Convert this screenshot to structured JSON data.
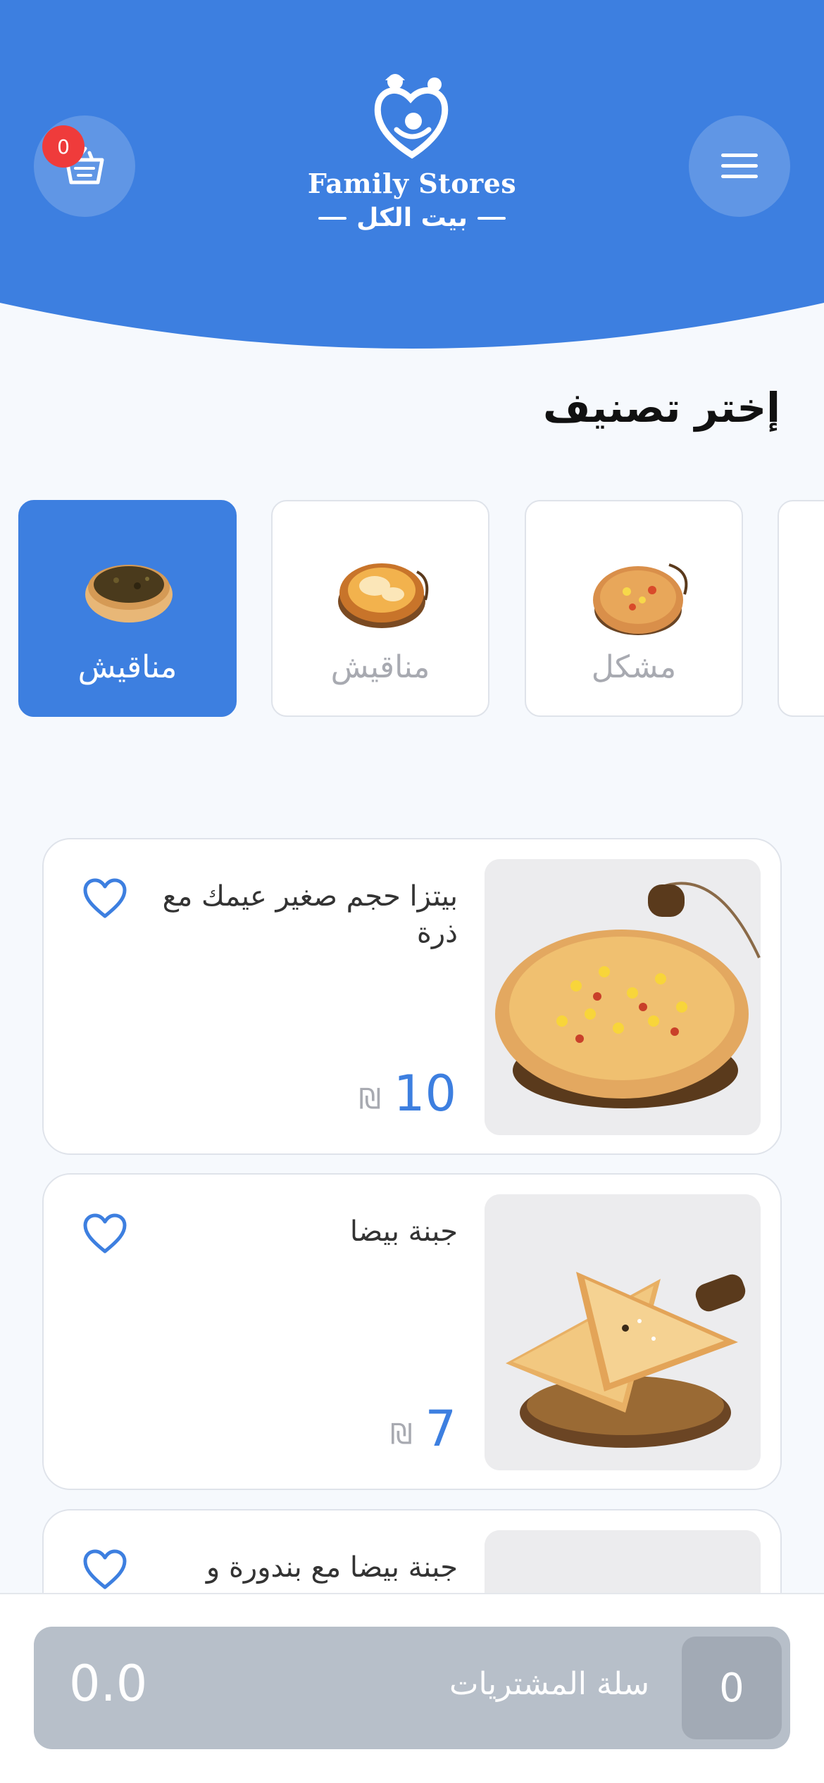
{
  "header": {
    "brand_en": "Family Stores",
    "brand_ar": "بيت الكل",
    "cart_badge": "0",
    "colors": {
      "primary": "#3d7fe0",
      "badge": "#ef3b3b"
    },
    "icons": {
      "cart": "basket-icon",
      "menu": "hamburger-menu-icon",
      "logo": "family-heart-logo-icon"
    }
  },
  "section": {
    "title": "إختر تصنيف"
  },
  "categories": [
    {
      "label": "مناقيش",
      "active": true
    },
    {
      "label": "مناقيش",
      "active": false
    },
    {
      "label": "مشكل",
      "active": false
    }
  ],
  "products": [
    {
      "name": "بيتزا حجم صغير عيمك مع ذرة",
      "price": "10",
      "currency": "₪"
    },
    {
      "name": "جبنة بيضا",
      "price": "7",
      "currency": "₪"
    },
    {
      "name": "جبنة بيضا مع بندورة و",
      "price": "",
      "currency": ""
    }
  ],
  "cart": {
    "total": "0.0",
    "label": "سلة المشتريات",
    "count": "0"
  }
}
